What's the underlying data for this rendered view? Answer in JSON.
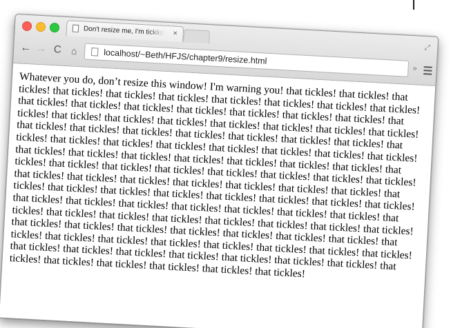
{
  "browser": {
    "tab": {
      "title": "Don't resize me, I'm ticklish!",
      "close_symbol": "×"
    },
    "address_bar": {
      "url": "localhost/~Beth/HFJS/chapter9/resize.html"
    },
    "icons": {
      "close": "traffic-light-close",
      "minimize": "traffic-light-minimize",
      "maximize": "traffic-light-maximize",
      "back": "←",
      "forward": "→",
      "reload": "C",
      "home": "⌂",
      "extensions": "»",
      "fullscreen": "⤢"
    },
    "colors": {
      "close": "#fc5f57",
      "minimize": "#fdbc2e",
      "maximize": "#2bc840"
    }
  },
  "page": {
    "body_text": "Whatever you do, don’t resize this window! I'm warning you! that tickles! that tickles! that tickles! that tickles! that tickles! that tickles! that tickles! that tickles! that tickles! that tickles! that tickles! that tickles! that tickles! that tickles! that tickles! that tickles! that tickles! that tickles! that tickles! that tickles! that tickles! that tickles! that tickles! that tickles! that tickles! that tickles! that tickles! that tickles! that tickles! that tickles! that tickles! that tickles! that tickles! that tickles! that tickles! that tickles! that tickles! that tickles! that tickles! that tickles! that tickles! that tickles! that tickles! that tickles! that tickles! that tickles! that tickles! that tickles! that tickles! that tickles! that tickles! that tickles! that tickles! that tickles! that tickles! that tickles! that tickles! that tickles! that tickles! that tickles! that tickles! that tickles! that tickles! that tickles! that tickles! that tickles! that tickles! that tickles! that tickles! that tickles! that tickles! that tickles! that tickles! that tickles! that tickles! that tickles! that tickles! that tickles! that tickles! that tickles! that tickles! that tickles! that tickles! that tickles! that tickles! that tickles! that tickles! that tickles! that tickles! that tickles! that tickles! that tickles! that tickles! that tickles! that tickles! that tickles! that tickles! that tickles! that tickles! that tickles! that tickles! that tickles! that tickles! that tickles! that tickles! that tickles! that tickles! that tickles! that tickles! that tickles! that tickles! that tickles! that tickles!"
  }
}
